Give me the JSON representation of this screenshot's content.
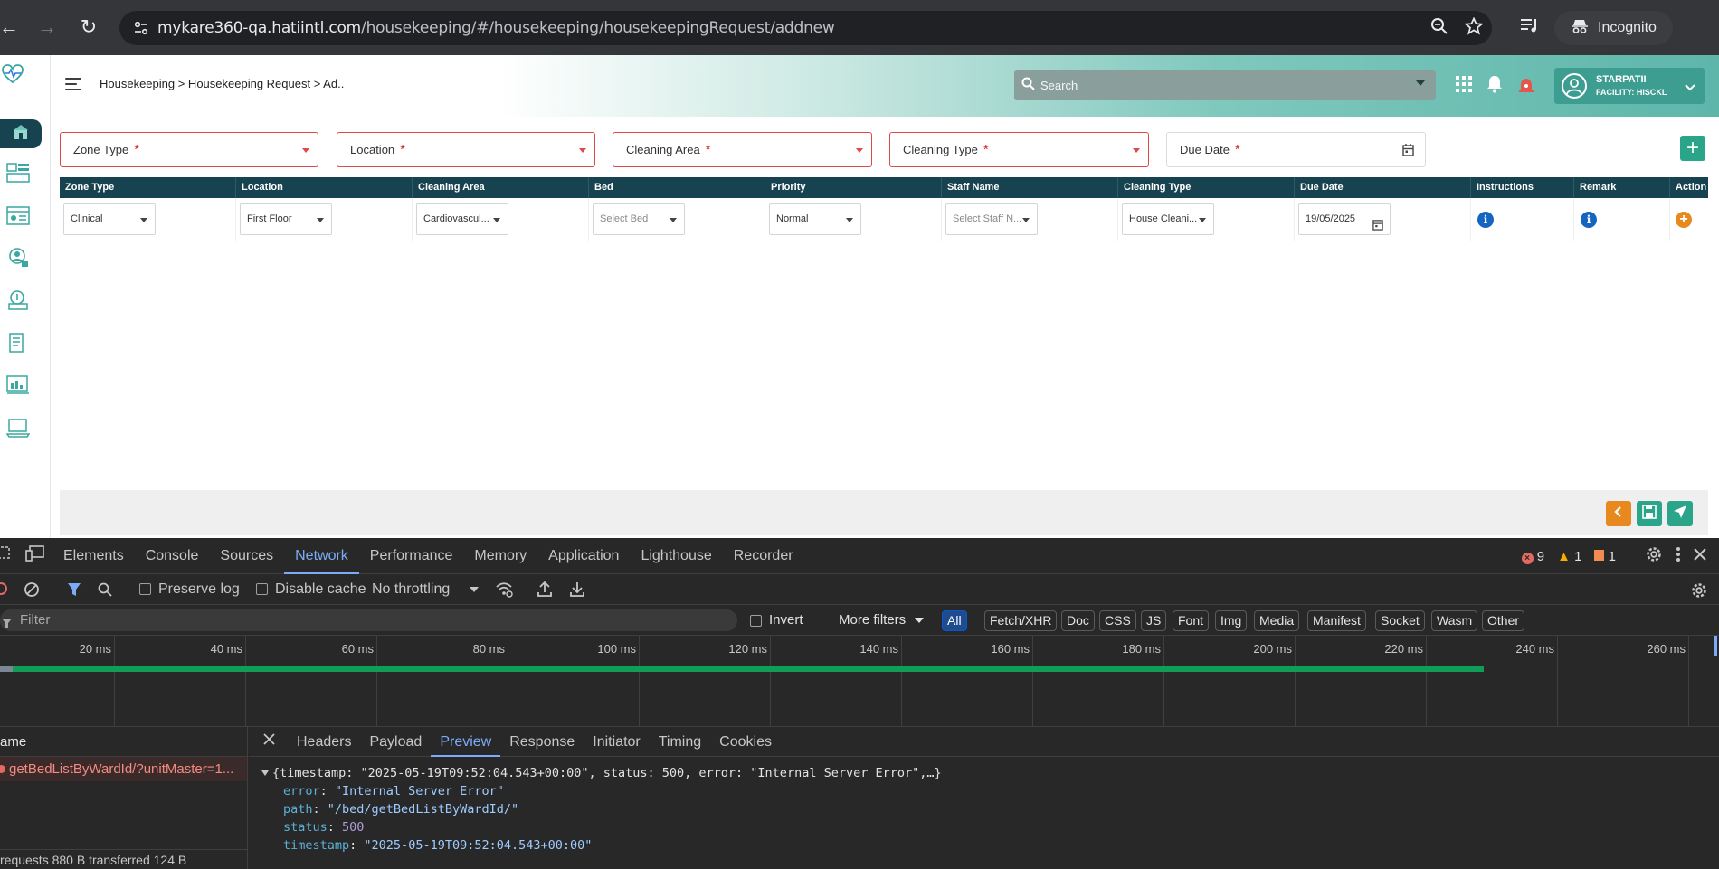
{
  "browser": {
    "url_host": "mykare360-qa.hatiintl.com",
    "url_path": "/housekeeping/#/housekeeping/housekeepingRequest/addnew",
    "incognito_label": "Incognito"
  },
  "app": {
    "breadcrumb": "Housekeeping > Housekeeping Request > Ad..",
    "search_placeholder": "Search",
    "user": {
      "name": "STARPATII",
      "facility": "FACILITY: HISCKL"
    },
    "form": {
      "zone_type_label": "Zone Type",
      "location_label": "Location",
      "cleaning_area_label": "Cleaning Area",
      "cleaning_type_label": "Cleaning Type",
      "due_date_label": "Due Date",
      "required_mark": "*",
      "add_label": "+"
    },
    "table": {
      "headers": [
        "Zone Type",
        "Location",
        "Cleaning Area",
        "Bed",
        "Priority",
        "Staff Name",
        "Cleaning Type",
        "Due Date",
        "Instructions",
        "Remark",
        "Action"
      ],
      "row": {
        "zone_type": "Clinical",
        "location": "First Floor",
        "cleaning_area": "Cardiovascul...",
        "bed": "Select Bed",
        "priority": "Normal",
        "staff_name": "Select Staff N...",
        "cleaning_type": "House Cleani...",
        "due_date": "19/05/2025",
        "instructions_icon": "i",
        "remark_icon": "i",
        "action_icon": "+"
      }
    },
    "colors": {
      "header_dark": "#17424f",
      "accent_green": "#2aa58a",
      "error_red": "#e04848",
      "orange": "#e8891f"
    }
  },
  "devtools": {
    "tabs": [
      "Elements",
      "Console",
      "Sources",
      "Network",
      "Performance",
      "Memory",
      "Application",
      "Lighthouse",
      "Recorder"
    ],
    "active_tab": "Network",
    "counts": {
      "errors": "9",
      "warnings": "1",
      "issues": "1"
    },
    "toolbar": {
      "preserve_log": "Preserve log",
      "disable_cache": "Disable cache",
      "throttling": "No throttling"
    },
    "filter": {
      "placeholder": "Filter",
      "invert": "Invert",
      "more_filters": "More filters",
      "chips": [
        "All",
        "Fetch/XHR",
        "Doc",
        "CSS",
        "JS",
        "Font",
        "Img",
        "Media",
        "Manifest",
        "Socket",
        "Wasm",
        "Other"
      ]
    },
    "timeline_ticks": [
      "20 ms",
      "40 ms",
      "60 ms",
      "80 ms",
      "100 ms",
      "120 ms",
      "140 ms",
      "160 ms",
      "180 ms",
      "200 ms",
      "220 ms",
      "240 ms",
      "260 ms"
    ],
    "requests": {
      "column": "ame",
      "items": [
        "getBedListByWardId/?unitMaster=1..."
      ],
      "summary": "requests   880 B transferred   124 B"
    },
    "detail_tabs": [
      "Headers",
      "Payload",
      "Preview",
      "Response",
      "Initiator",
      "Timing",
      "Cookies"
    ],
    "active_detail_tab": "Preview",
    "preview": {
      "summary": "{timestamp: \"2025-05-19T09:52:04.543+00:00\", status: 500, error: \"Internal Server Error\",…}",
      "fields": [
        {
          "key": "error",
          "value": "\"Internal Server Error\"",
          "kind": "str"
        },
        {
          "key": "path",
          "value": "\"/bed/getBedListByWardId/\"",
          "kind": "str"
        },
        {
          "key": "status",
          "value": "500",
          "kind": "num"
        },
        {
          "key": "timestamp",
          "value": "\"2025-05-19T09:52:04.543+00:00\"",
          "kind": "str"
        }
      ]
    }
  }
}
